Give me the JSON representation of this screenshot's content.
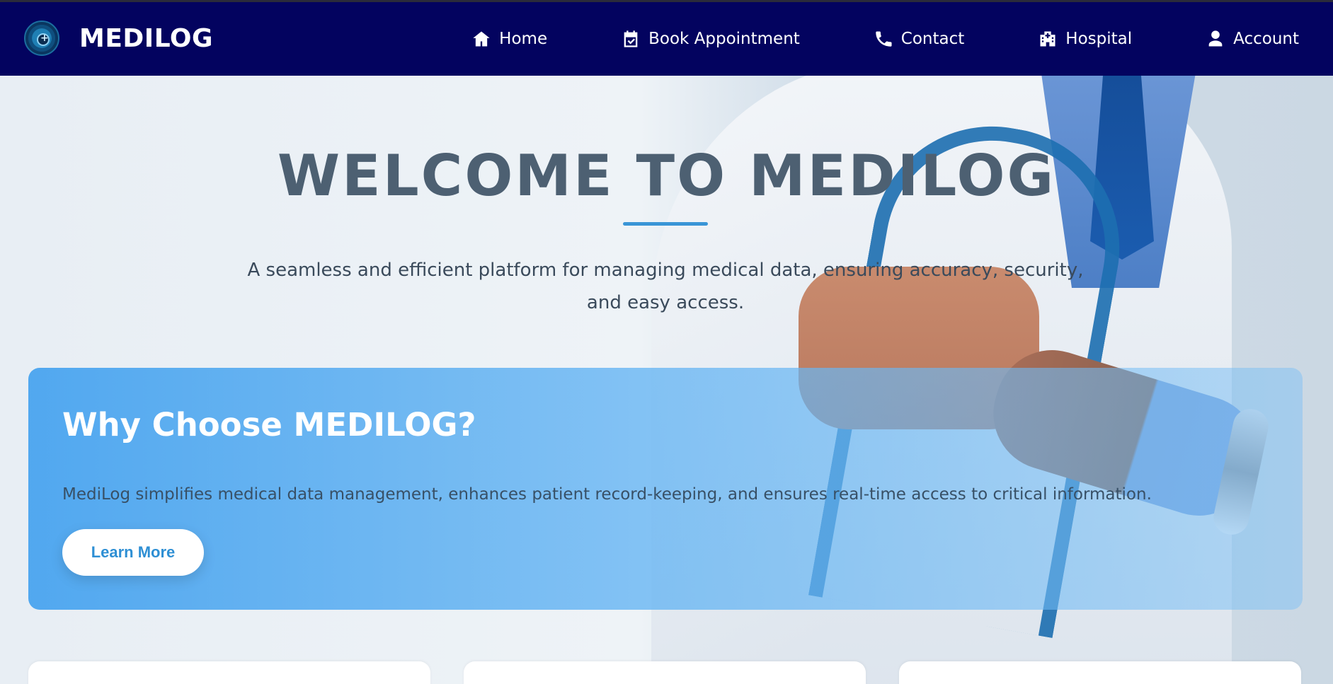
{
  "header": {
    "brand": "MEDILOG",
    "nav": [
      {
        "label": "Home",
        "icon": "home-icon"
      },
      {
        "label": "Book Appointment",
        "icon": "calendar-check-icon"
      },
      {
        "label": "Contact",
        "icon": "phone-icon"
      },
      {
        "label": "Hospital",
        "icon": "hospital-icon"
      },
      {
        "label": "Account",
        "icon": "user-icon"
      }
    ]
  },
  "hero": {
    "title": "WELCOME TO MEDILOG",
    "subtitle": "A seamless and efficient platform for managing medical data, ensuring accuracy, security, and easy access."
  },
  "why": {
    "title": "Why Choose MEDILOG?",
    "text": "MediLog simplifies medical data management, enhances patient record-keeping, and ensures real-time access to critical information.",
    "button": "Learn More"
  },
  "colors": {
    "navbar": "#03035f",
    "accent": "#3995d6",
    "panel": "#4aa4ef",
    "title": "#4d6072"
  }
}
